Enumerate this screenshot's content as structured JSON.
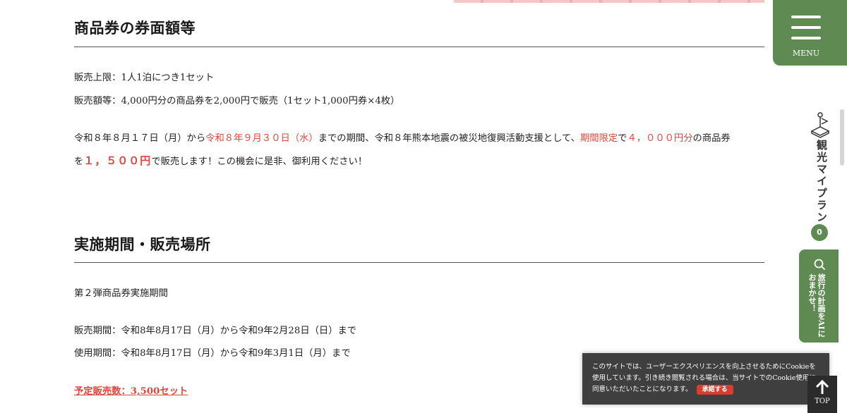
{
  "section1": {
    "title": "商品券の券面額等",
    "limit": "販売上限：1人1泊につき1セット",
    "price": "販売額等：4,000円分の商品券を2,000円で販売（1セット1,000円券×4枚）",
    "promo": {
      "t1": "令和８年８月１７日（月）から",
      "t2": "令和８年９月３０日（水）",
      "t3": "までの期間、令和８年熊本地震の被災地復興活動支援として、",
      "t4": "期間限定",
      "t5": "で",
      "t6": "４，０００円分",
      "t7": "の商品券",
      "t8": "を",
      "t9": "１，５００円",
      "t10": "で販売します！この機会に是非、御利用ください！"
    }
  },
  "section2": {
    "title": "実施期間・販売場所",
    "subtitle": "第２弾商品券実施期間",
    "sale_period": "販売期間：令和8年8月17日（月）から令和9年2月28日（日）まで",
    "use_period": "使用期間：令和8年8月17日（月）から令和9年3月1日（月）まで",
    "planned": "予定販売数：3,500セット"
  },
  "sidebar": {
    "menu_label": "MENU",
    "plan_label": "観光マイプラン",
    "plan_count": "0",
    "ai_label": "旅行の計画をAIにおまかせ！"
  },
  "cookie": {
    "text": "このサイトでは、ユーザーエクスペリエンスを向上させるためにCookieを使用しています。引き続き閲覧される場合は、当サイトでのCookie使用に同意いただいたことになります。",
    "accept_label": "承諾する"
  },
  "top_button": {
    "label": "TOP"
  },
  "colors": {
    "accent_green": "#5f8a52",
    "accent_red": "#e0463b",
    "cookie_bg": "#3f3f3f"
  }
}
